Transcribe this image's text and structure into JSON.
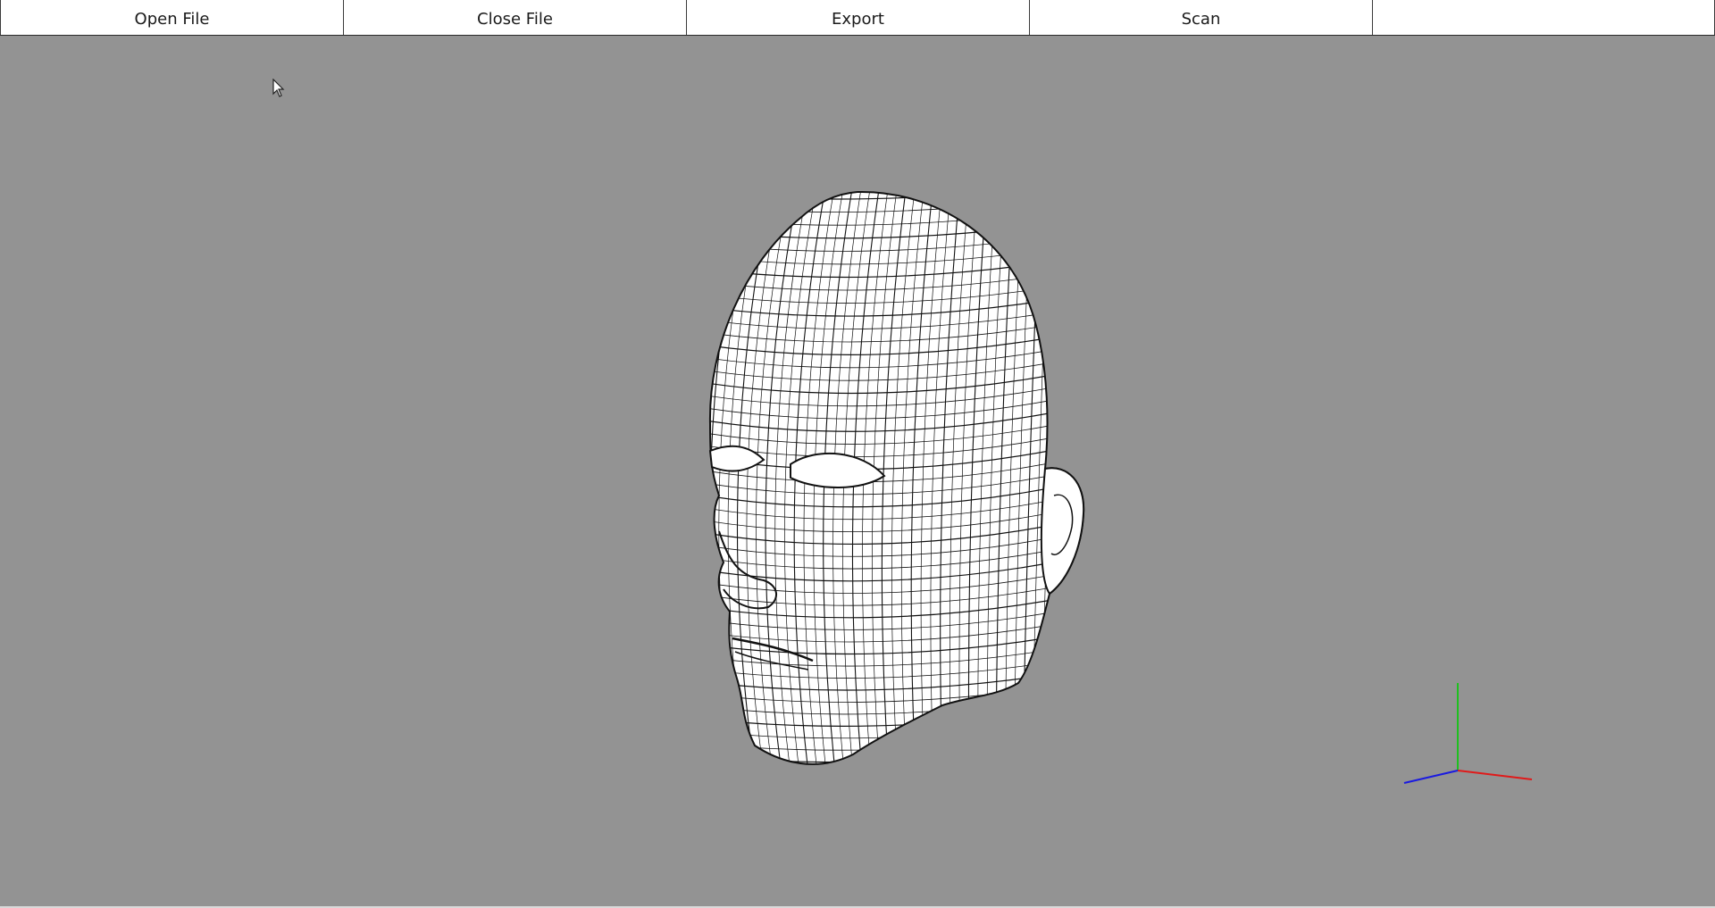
{
  "toolbar": {
    "buttons": [
      {
        "label": "Open File"
      },
      {
        "label": "Close File"
      },
      {
        "label": "Export"
      },
      {
        "label": "Scan"
      },
      {
        "label": ""
      }
    ]
  },
  "viewport": {
    "background": "#939393",
    "model_icon": "wireframe-head-model",
    "axis_colors": {
      "x": "#e02020",
      "y": "#20c020",
      "z": "#2020e0"
    }
  }
}
